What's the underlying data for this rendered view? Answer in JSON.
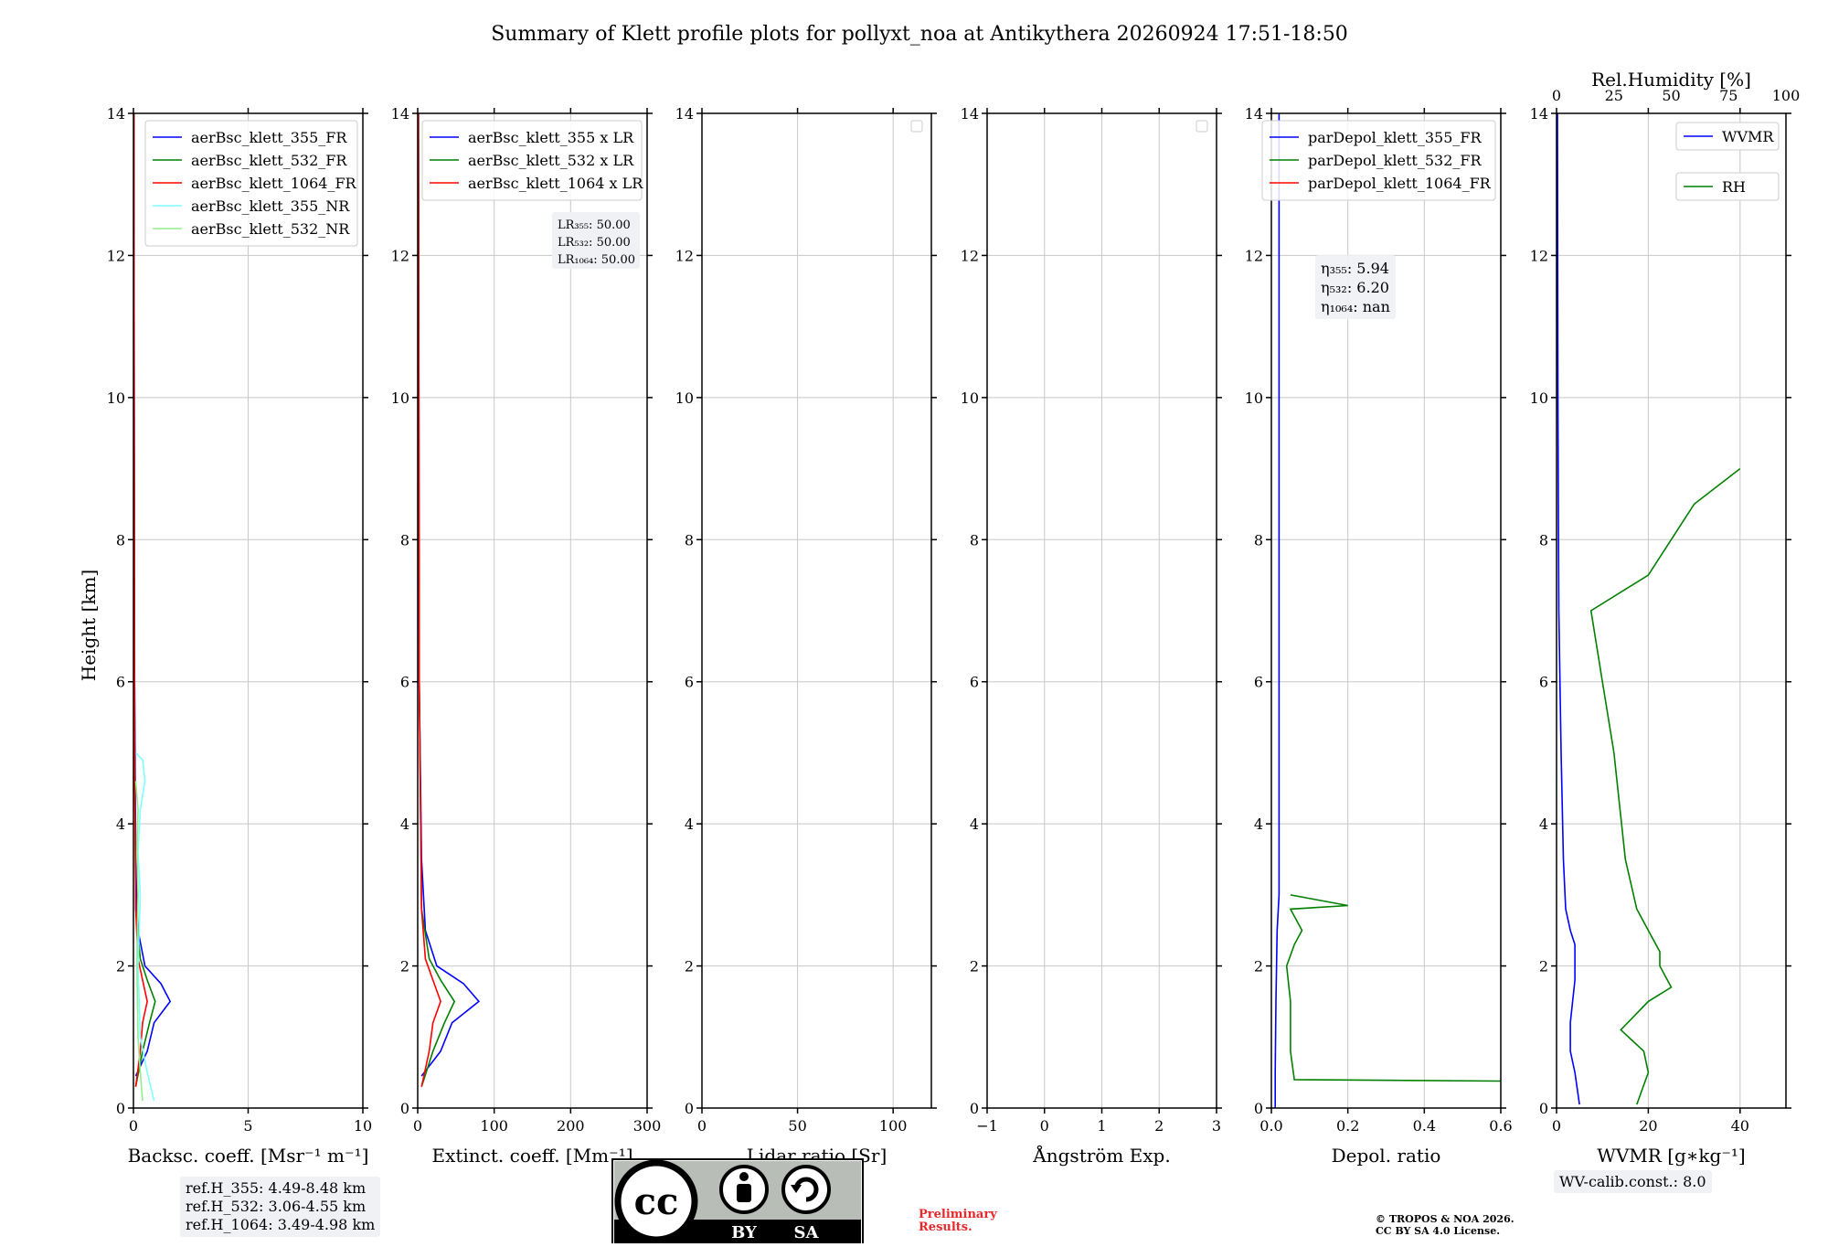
{
  "title": "Summary of Klett profile plots for pollyxt_noa at Antikythera 20260924 17:51-18:50",
  "ylabel": "Height [km]",
  "yticks": [
    "0",
    "2",
    "4",
    "6",
    "8",
    "10",
    "12",
    "14"
  ],
  "colors": {
    "blue": "#0000ff",
    "green": "#008000",
    "red": "#ff0000",
    "cyan": "#7fffff",
    "lightgreen": "#90ee90"
  },
  "chart_data": [
    {
      "type": "line",
      "xlabel": "Backsc. coeff. [Msr⁻¹ m⁻¹]",
      "xlim": [
        0,
        10
      ],
      "xticks": [
        "0",
        "5",
        "10"
      ],
      "ylim": [
        0,
        14
      ],
      "legend": "upper-right",
      "series": [
        {
          "name": "aerBsc_klett_355_FR",
          "color": "#0000ff",
          "x": [
            0.1,
            0.6,
            0.9,
            1.6,
            1.2,
            0.5,
            0.2,
            0.1,
            0.05,
            0.03,
            0.02
          ],
          "y": [
            0.45,
            0.8,
            1.2,
            1.5,
            1.75,
            2.0,
            2.5,
            3.5,
            6.0,
            10.0,
            14.0
          ]
        },
        {
          "name": "aerBsc_klett_532_FR",
          "color": "#008000",
          "x": [
            0.1,
            0.4,
            0.7,
            0.95,
            0.6,
            0.3,
            0.1,
            0.05,
            0.03,
            0.02
          ],
          "y": [
            0.3,
            0.8,
            1.2,
            1.5,
            1.8,
            2.1,
            2.8,
            5.0,
            10.0,
            14.0
          ]
        },
        {
          "name": "aerBsc_klett_1064_FR",
          "color": "#ff0000",
          "x": [
            0.1,
            0.3,
            0.4,
            0.6,
            0.4,
            0.2,
            0.1,
            0.05,
            0.03,
            0.02
          ],
          "y": [
            0.3,
            0.8,
            1.2,
            1.5,
            1.8,
            2.1,
            2.8,
            5.0,
            10.0,
            14.0
          ]
        },
        {
          "name": "aerBsc_klett_355_NR",
          "color": "#7fffff",
          "x": [
            0.9,
            0.6,
            0.3,
            0.2,
            0.3,
            0.2,
            0.3,
            0.5,
            0.4,
            0.1
          ],
          "y": [
            0.1,
            0.5,
            1.0,
            2.0,
            3.0,
            3.6,
            4.2,
            4.6,
            4.9,
            5.0
          ]
        },
        {
          "name": "aerBsc_klett_532_NR",
          "color": "#90ee90",
          "x": [
            0.4,
            0.3,
            0.2,
            0.15,
            0.2,
            0.15,
            0.2,
            0.1
          ],
          "y": [
            0.1,
            0.5,
            1.0,
            2.0,
            3.0,
            3.6,
            4.2,
            4.6
          ]
        }
      ]
    },
    {
      "type": "line",
      "xlabel": "Extinct. coeff. [Mm⁻¹]",
      "xlim": [
        0,
        300
      ],
      "xticks": [
        "0",
        "100",
        "200",
        "300"
      ],
      "ylim": [
        0,
        14
      ],
      "legend": "upper-right",
      "annotation": [
        "LR₃₅₅: 50.00",
        "LR₅₃₂: 50.00",
        "LR₁₀₆₄: 50.00"
      ],
      "series": [
        {
          "name": "aerBsc_klett_355 x LR",
          "color": "#0000ff",
          "x": [
            5,
            30,
            45,
            80,
            60,
            25,
            10,
            5,
            2,
            1
          ],
          "y": [
            0.45,
            0.8,
            1.2,
            1.5,
            1.75,
            2.0,
            2.5,
            3.5,
            6.0,
            14.0
          ]
        },
        {
          "name": "aerBsc_klett_532 x LR",
          "color": "#008000",
          "x": [
            5,
            20,
            35,
            48,
            30,
            15,
            5,
            2,
            1
          ],
          "y": [
            0.3,
            0.8,
            1.2,
            1.5,
            1.8,
            2.1,
            2.8,
            6.0,
            14.0
          ]
        },
        {
          "name": "aerBsc_klett_1064 x LR",
          "color": "#ff0000",
          "x": [
            5,
            15,
            20,
            30,
            20,
            10,
            5,
            2,
            1
          ],
          "y": [
            0.3,
            0.8,
            1.2,
            1.5,
            1.8,
            2.1,
            2.8,
            6.0,
            14.0
          ]
        }
      ]
    },
    {
      "type": "line",
      "xlabel": "Lidar ratio [Sr]",
      "xlim": [
        0,
        120
      ],
      "xticks": [
        "0",
        "50",
        "100"
      ],
      "ylim": [
        0,
        14
      ],
      "series": []
    },
    {
      "type": "line",
      "xlabel": "Ångström Exp.",
      "xlim": [
        -1,
        3
      ],
      "xticks": [
        "−1",
        "0",
        "1",
        "2",
        "3"
      ],
      "ylim": [
        0,
        14
      ],
      "series": []
    },
    {
      "type": "line",
      "xlabel": "Depol. ratio",
      "xlim": [
        0,
        0.6
      ],
      "xticks": [
        "0.0",
        "0.2",
        "0.4",
        "0.6"
      ],
      "ylim": [
        0,
        14
      ],
      "legend": "upper-right",
      "annotation": [
        "η₃₅₅: 5.94",
        "η₅₃₂: 6.20",
        "η₁₀₆₄: nan"
      ],
      "series": [
        {
          "name": "parDepol_klett_355_FR",
          "color": "#0000ff",
          "x": [
            0.01,
            0.01,
            0.012,
            0.015,
            0.02,
            0.02
          ],
          "y": [
            0.0,
            0.5,
            1.5,
            2.5,
            3.0,
            14.0
          ]
        },
        {
          "name": "parDepol_klett_532_FR",
          "color": "#008000",
          "x": [
            0.6,
            0.06,
            0.05,
            0.05,
            0.04,
            0.06,
            0.08,
            0.05,
            0.2,
            0.05
          ],
          "y": [
            0.38,
            0.4,
            0.8,
            1.5,
            2.0,
            2.3,
            2.5,
            2.8,
            2.85,
            3.0
          ]
        },
        {
          "name": "parDepol_klett_1064_FR",
          "color": "#ff0000",
          "x": [],
          "y": []
        }
      ]
    },
    {
      "type": "line",
      "xlabel": "WVMR [g∗kg⁻¹]",
      "xlim": [
        0,
        50
      ],
      "xticks": [
        "0",
        "20",
        "40"
      ],
      "x2label": "Rel.Humidity [%]",
      "x2lim": [
        0,
        100
      ],
      "x2ticks": [
        "0",
        "25",
        "50",
        "75",
        "100"
      ],
      "ylim": [
        0,
        14
      ],
      "series": [
        {
          "name": "WVMR",
          "color": "#0000ff",
          "axis": "bottom",
          "x": [
            5,
            4,
            3,
            3,
            4,
            4,
            3,
            2,
            1.5,
            1,
            0.5,
            0.3,
            0.2
          ],
          "y": [
            0.05,
            0.5,
            0.8,
            1.2,
            1.8,
            2.3,
            2.5,
            2.8,
            3.5,
            5.0,
            7.0,
            10.0,
            14.0
          ]
        },
        {
          "name": "RH",
          "color": "#008000",
          "axis": "top",
          "x": [
            35,
            40,
            38,
            28,
            40,
            50,
            45,
            45,
            40,
            35,
            30,
            25,
            20,
            15,
            40,
            60,
            80
          ],
          "y": [
            0.05,
            0.5,
            0.8,
            1.1,
            1.5,
            1.7,
            2.0,
            2.2,
            2.5,
            2.8,
            3.5,
            5.0,
            6.0,
            7.0,
            7.5,
            8.5,
            9.0
          ]
        }
      ]
    }
  ],
  "refbox": [
    "ref.H_355: 4.49-8.48 km",
    "ref.H_532: 3.06-4.55 km",
    "ref.H_1064: 3.49-4.98 km"
  ],
  "wvcalib": "WV-calib.const.: 8.0",
  "license_badge": {
    "cc": "cc",
    "by": "BY",
    "sa": "SA"
  },
  "prelim": [
    "Preliminary",
    "Results."
  ],
  "copyright": [
    "© TROPOS & NOA 2026.",
    "CC BY SA 4.0 License."
  ]
}
